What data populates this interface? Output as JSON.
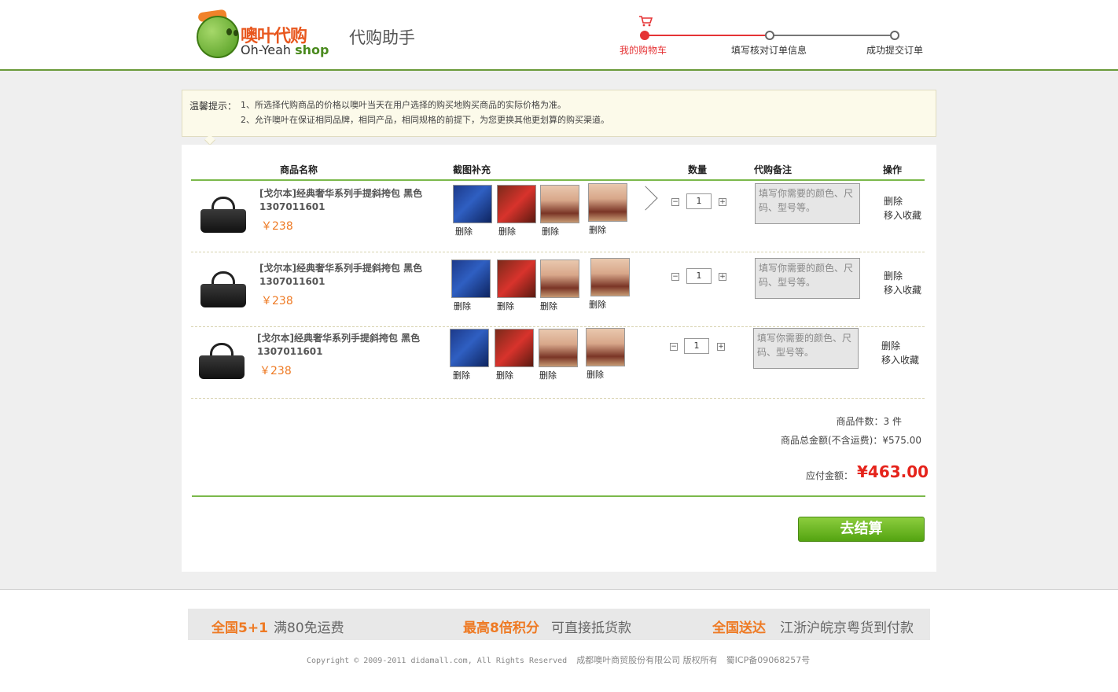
{
  "brand": {
    "logo_cn": "噢叶代购",
    "logo_en_a": "Oh-Yeah ",
    "logo_en_b": "shop",
    "subtitle": "代购助手"
  },
  "steps": [
    "我的购物车",
    "填写核对订单信息",
    "成功提交订单"
  ],
  "tip": {
    "label": "温馨提示：",
    "lines": [
      "1、所选择代购商品的价格以噢叶当天在用户选择的购买地购买商品的实际价格为准。",
      "2、允许噢叶在保证相同品牌，相同产品，相同规格的前提下，为您更换其他更划算的购买渠道。"
    ]
  },
  "table": {
    "headers": {
      "name": "商品名称",
      "screenshots": "截图补充",
      "qty": "数量",
      "note": "代购备注",
      "action": "操作"
    },
    "rows": [
      {
        "name": "[戈尔本]经典奢华系列手提斜挎包 黑色 1307011601",
        "price": "￥238",
        "qty": "1",
        "note_placeholder": "填写你需要的颜色、尺码、型号等。",
        "shots": [
          "blue",
          "red",
          "pink",
          "pink"
        ],
        "shot_delete": "删除",
        "action_delete": "删除",
        "action_fav": "移入收藏"
      },
      {
        "name": "[戈尔本]经典奢华系列手提斜挎包 黑色 1307011601",
        "price": "￥238",
        "qty": "1",
        "note_placeholder": "填写你需要的颜色、尺码、型号等。",
        "shots": [
          "blue",
          "red",
          "pink",
          "pink"
        ],
        "shot_delete": "删除",
        "action_delete": "删除",
        "action_fav": "移入收藏"
      },
      {
        "name": "[戈尔本]经典奢华系列手提斜挎包 黑色 1307011601",
        "price": "￥238",
        "qty": "1",
        "note_placeholder": "填写你需要的颜色、尺码、型号等。",
        "shots": [
          "blue",
          "red",
          "pink",
          "pink"
        ],
        "shot_delete": "删除",
        "action_delete": "删除",
        "action_fav": "移入收藏"
      }
    ]
  },
  "summary": {
    "count": "商品件数：3 件",
    "total": "商品总金额(不含运费)：¥575.00",
    "pay_label": "应付金额：",
    "pay_amount": "¥463.00",
    "checkout": "去结算"
  },
  "footer": {
    "items": [
      {
        "highlight": "全国5+1",
        "text": "满80免运费"
      },
      {
        "highlight": "最高8倍积分",
        "text": "可直接抵货款"
      },
      {
        "highlight": "全国送达",
        "text": "江浙沪皖京粤货到付款"
      }
    ],
    "copyright_en": "Copyright © 2009-2011 didamall.com, All Rights Reserved",
    "copyright_cn": "成都噢叶商贸股份有限公司 版权所有　蜀ICP备09068257号"
  },
  "colors": {
    "accent_green": "#7bb94b",
    "accent_red": "#e5231b",
    "accent_orange": "#ee7a24"
  }
}
